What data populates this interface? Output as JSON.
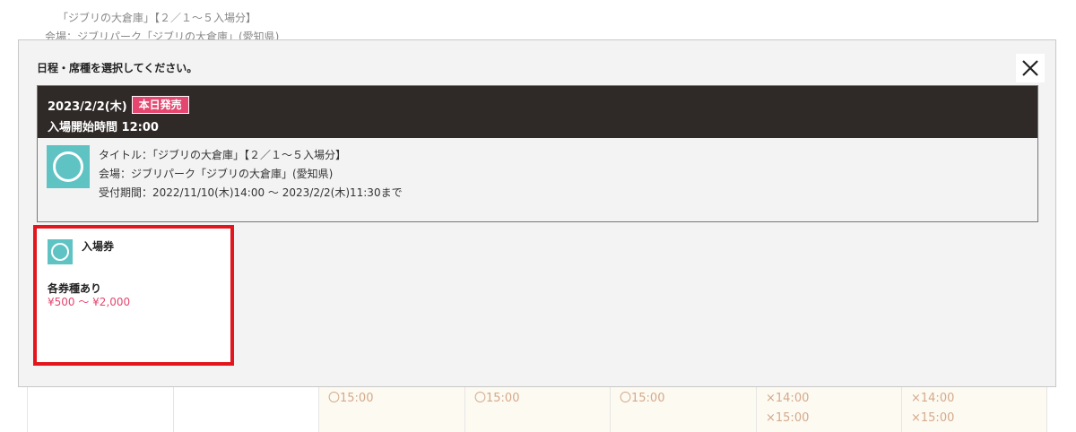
{
  "background": {
    "title_line": "「ジブリの大倉庫」【２／１～５入場分】",
    "venue_line": "会場：ジブリパーク「ジブリの大倉庫」(愛知県)",
    "table_cells": [
      [
        "",
        ""
      ],
      [
        "",
        ""
      ],
      [
        "〇15:00",
        ""
      ],
      [
        "〇15:00",
        ""
      ],
      [
        "〇15:00",
        ""
      ],
      [
        "×14:00",
        "×15:00"
      ],
      [
        "×14:00",
        "×15:00"
      ]
    ]
  },
  "modal": {
    "title": "日程・席種を選択してください。",
    "close_icon": "close-icon",
    "event": {
      "date": "2023/2/2(木)",
      "badge": "本日発売",
      "start_time": "入場開始時間 12:00",
      "icon": "circle-mark-icon",
      "icon_color": "#5fc3c4",
      "title_line": "タイトル：「ジブリの大倉庫」【２／１～５入場分】",
      "venue_line": "会場：ジブリパーク「ジブリの大倉庫」(愛知県)",
      "period_line": "受付期間：2022/11/10(木)14:00 ～ 2023/2/2(木)11:30まで"
    },
    "ticket": {
      "icon": "circle-mark-icon",
      "name": "入場券",
      "type": "各券種あり",
      "price_range": "¥500 ～ ¥2,000"
    }
  },
  "colors": {
    "accent_pink": "#e5466f",
    "highlight_red": "#e3161d",
    "header_dark": "#2f2a28",
    "teal": "#5fc3c4"
  }
}
